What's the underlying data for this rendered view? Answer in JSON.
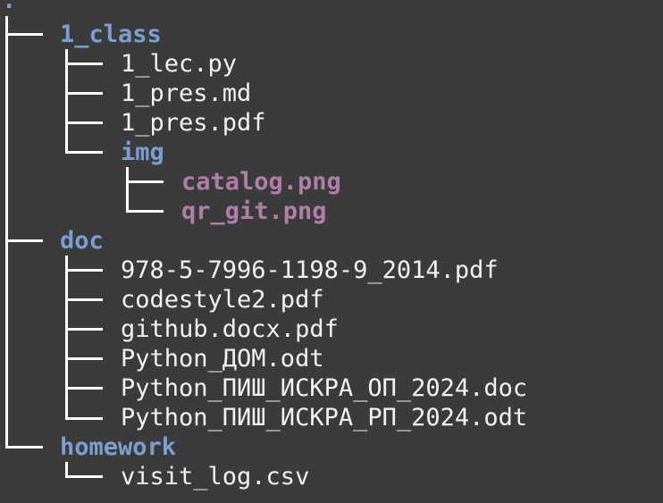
{
  "tree": {
    "root": ".",
    "class_dir": {
      "name": "1_class",
      "files": [
        "1_lec.py",
        "1_pres.md",
        "1_pres.pdf"
      ],
      "img_dir": {
        "name": "img",
        "files": [
          "catalog.png",
          "qr_git.png"
        ]
      }
    },
    "doc_dir": {
      "name": "doc",
      "files": [
        "978-5-7996-1198-9_2014.pdf",
        "codestyle2.pdf",
        "github.docx.pdf",
        "Python_ДОМ.odt",
        "Python_ПИШ_ИСКРА_ОП_2024.doc",
        "Python_ПИШ_ИСКРА_РП_2024.odt"
      ]
    },
    "homework_dir": {
      "name": "homework",
      "files": [
        "visit_log.csv"
      ]
    }
  },
  "colors": {
    "background": "#3b3b3b",
    "directory": "#7b9fd3",
    "image_file": "#b07fa8",
    "regular_file": "#f2f2f2",
    "tree_lines": "#ffffff"
  }
}
